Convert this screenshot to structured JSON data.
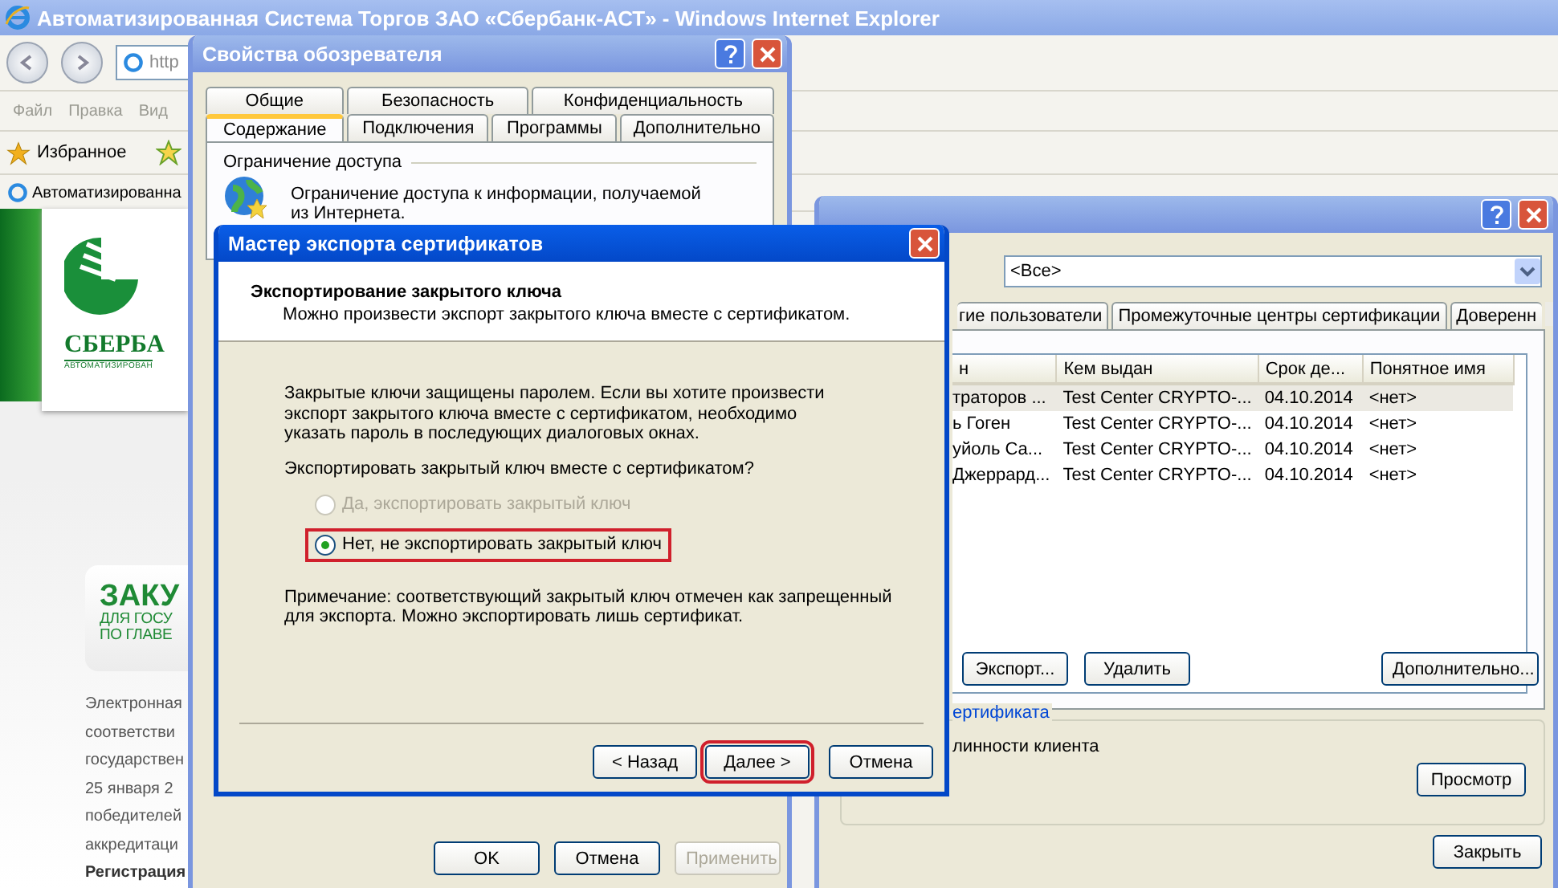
{
  "browser": {
    "title": "Автоматизированная Система Торгов ЗАО «Сбербанк-АСТ» - Windows Internet Explorer",
    "address": "http",
    "menu": [
      "Файл",
      "Правка",
      "Вид"
    ],
    "favorites": "Избранное",
    "tab": "Автоматизированна",
    "page": {
      "logo_text": "СБЕРБА",
      "logo_subtitle": "АВТОМАТИЗИРОВАН",
      "banner_lines": [
        "ЗАКУ",
        "ДЛЯ ГОСУ",
        "ПО ГЛАВЕ"
      ],
      "paragraph_lines": [
        "Электронная",
        "соответстви",
        "государствен",
        "25 января 2",
        "победителей",
        "аккредитаци"
      ],
      "bold_line": "Регистрация"
    }
  },
  "internet_options": {
    "title": "Свойства обозревателя",
    "tab_rows": [
      [
        {
          "label": "Общие",
          "selected": false
        },
        {
          "label": "Безопасность",
          "selected": false
        },
        {
          "label": "Конфиденциальность",
          "selected": false
        }
      ],
      [
        {
          "label": "Содержание",
          "selected": true
        },
        {
          "label": "Подключения",
          "selected": false
        },
        {
          "label": "Программы",
          "selected": false
        },
        {
          "label": "Дополнительно",
          "selected": false
        }
      ]
    ],
    "group": "Ограничение доступа",
    "description": "Ограничение доступа к информации, получаемой из Интернета.",
    "buttons": [
      {
        "label": "OK",
        "disabled": false
      },
      {
        "label": "Отмена",
        "disabled": false
      },
      {
        "label": "Применить",
        "disabled": true
      }
    ]
  },
  "certificates": {
    "filter": "<Все>",
    "tabs": [
      "гие пользователи",
      "Промежуточные центры сертификации",
      "Доверенн"
    ],
    "columns": [
      "н",
      "Кем выдан",
      "Срок де...",
      "Понятное имя"
    ],
    "rows": [
      {
        "cells": [
          "траторов ...",
          "Test Center CRYPTO-...",
          "04.10.2014",
          "<нет>"
        ],
        "selected": true
      },
      {
        "cells": [
          "ь Гоген",
          "Test Center CRYPTO-...",
          "04.10.2014",
          "<нет>"
        ],
        "selected": false
      },
      {
        "cells": [
          "уйоль Са...",
          "Test Center CRYPTO-...",
          "04.10.2014",
          "<нет>"
        ],
        "selected": false
      },
      {
        "cells": [
          "Джеррард...",
          "Test Center CRYPTO-...",
          "04.10.2014",
          "<нет>"
        ],
        "selected": false
      }
    ],
    "buttons": [
      "Экспорт...",
      "Удалить",
      "Дополнительно..."
    ],
    "group_label": "ертификата",
    "group_text": "линности клиента",
    "view_button": "Просмотр",
    "close_button": "Закрыть"
  },
  "wizard": {
    "title": "Мастер экспорта сертификатов",
    "heading": "Экспортирование закрытого ключа",
    "subheading": "Можно произвести экспорт закрытого ключа вместе с сертификатом.",
    "text": "Закрытые ключи защищены паролем. Если вы хотите произвести экспорт закрытого ключа вместе с сертификатом, необходимо указать пароль в последующих диалоговых окнах.",
    "question": "Экспортировать закрытый ключ вместе с сертификатом?",
    "options": [
      {
        "label": "Да, экспортировать закрытый ключ",
        "selected": false,
        "disabled": true,
        "highlighted": false
      },
      {
        "label": "Нет, не экспортировать закрытый ключ",
        "selected": true,
        "disabled": false,
        "highlighted": true
      }
    ],
    "note": "Примечание: соответствующий закрытый ключ отмечен как запрещенный для экспорта. Можно экспортировать лишь сертификат.",
    "buttons": [
      {
        "label": "< Назад",
        "highlighted": false
      },
      {
        "label": "Далее >",
        "highlighted": true
      },
      {
        "label": "Отмена",
        "highlighted": false
      }
    ]
  }
}
